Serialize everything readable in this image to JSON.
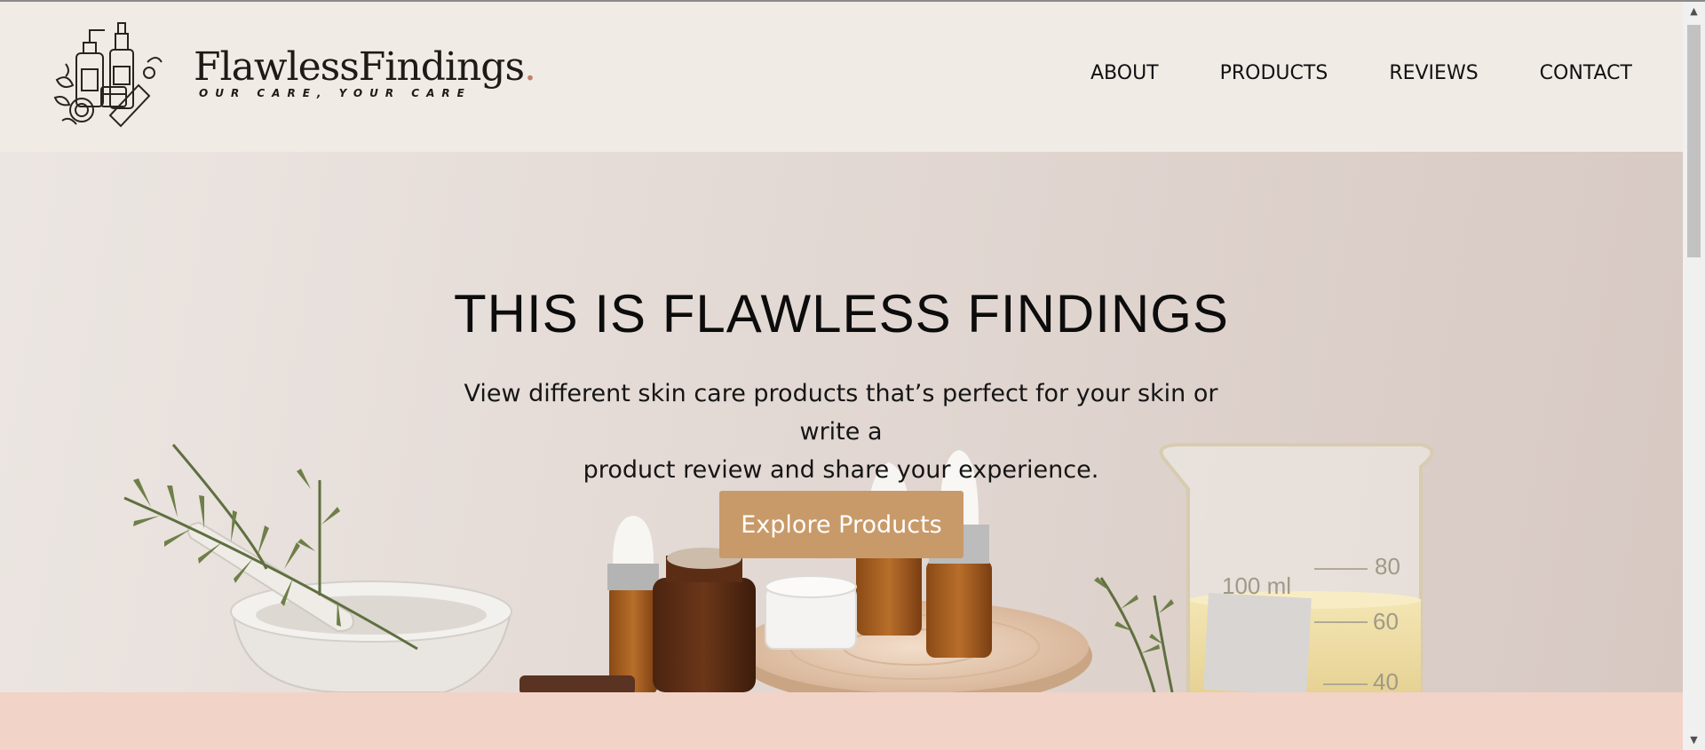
{
  "brand": {
    "name": "FlawlessFindings",
    "dot": ".",
    "tagline": "OUR CARE, YOUR CARE"
  },
  "nav": {
    "items": [
      {
        "label": "ABOUT"
      },
      {
        "label": "PRODUCTS"
      },
      {
        "label": "REVIEWS"
      },
      {
        "label": "CONTACT"
      }
    ]
  },
  "hero": {
    "title": "THIS IS FLAWLESS FINDINGS",
    "subtitle_line1": "View different skin care products that’s perfect for your skin or write a",
    "subtitle_line2": "product review and share your experience.",
    "cta": "Explore Products",
    "beaker_label_100": "100 ml",
    "beaker_label_80": "80",
    "beaker_label_60": "60",
    "beaker_label_40": "40"
  },
  "colors": {
    "header_bg": "#f1ebe6",
    "cta_bg": "#c89a69",
    "strip_bg": "#f2d3c8"
  },
  "icons": {
    "logo": "skincare-bottles-illustration",
    "scroll_up": "triangle-up-icon",
    "scroll_down": "triangle-down-icon"
  }
}
